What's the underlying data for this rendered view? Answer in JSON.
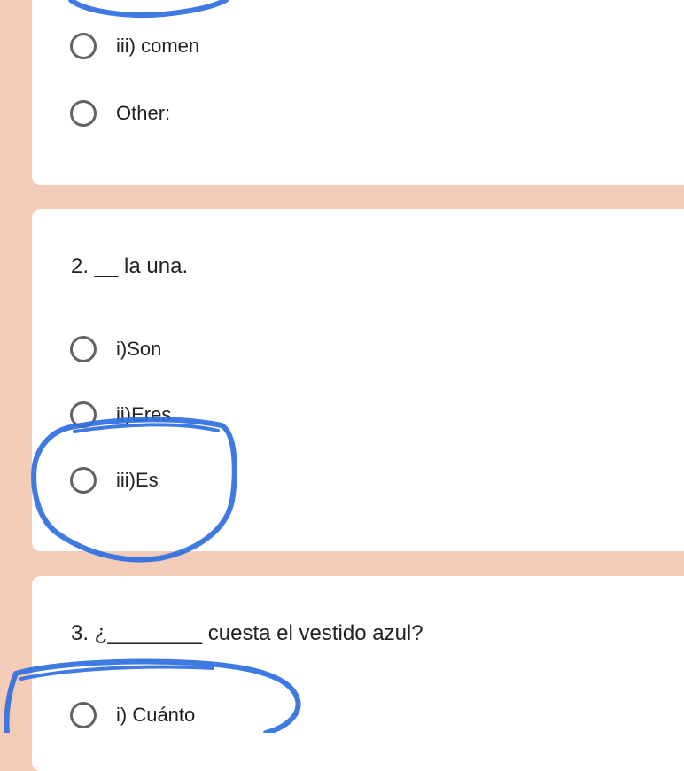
{
  "question1": {
    "options": [
      "iii) comen",
      "Other:"
    ]
  },
  "question2": {
    "text": "2. __ la una.",
    "options": [
      "i)Son",
      "ii)Eres",
      "iii)Es"
    ]
  },
  "question3": {
    "text": "3. ¿________ cuesta el vestido azul?",
    "options": [
      "i) Cuánto"
    ]
  },
  "colors": {
    "background": "#f3cbb9",
    "card": "#ffffff",
    "radio_border": "#5f6368",
    "annotation": "#2f6fe0"
  }
}
